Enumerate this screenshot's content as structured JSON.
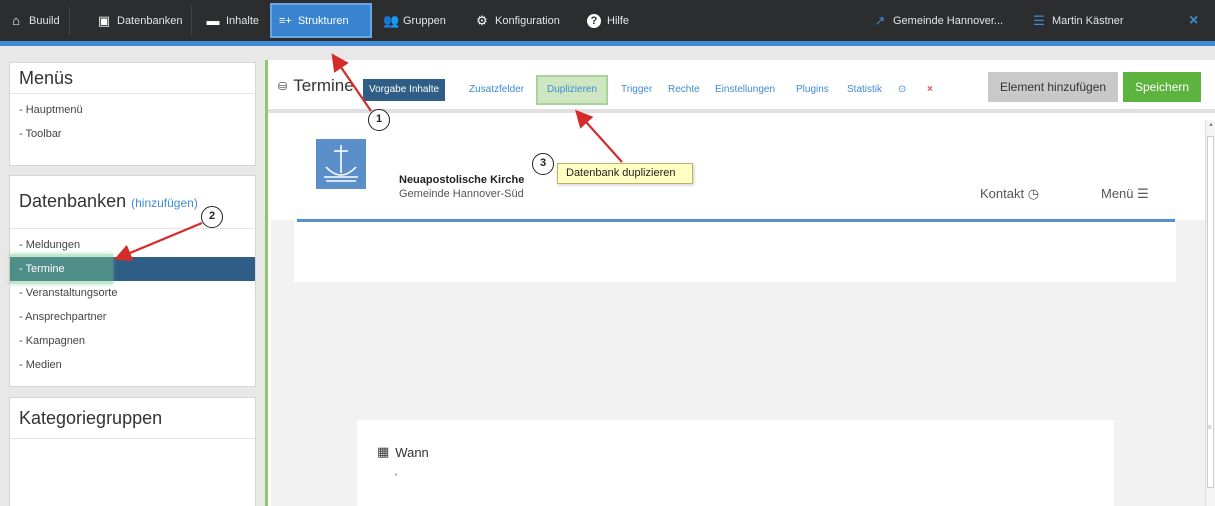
{
  "nav": {
    "items": [
      {
        "label": "Buuild",
        "icon": "home-icon"
      },
      {
        "label": "Datenbanken",
        "icon": "calendar-icon"
      },
      {
        "label": "Inhalte",
        "icon": "folder-icon"
      },
      {
        "label": "Strukturen",
        "icon": "structure-icon",
        "active": true
      },
      {
        "label": "Gruppen",
        "icon": "users-icon"
      },
      {
        "label": "Konfiguration",
        "icon": "gear-icon"
      },
      {
        "label": "Hilfe",
        "icon": "help-icon"
      }
    ],
    "site": "Gemeinde Hannover...",
    "user": "Martin Kästner",
    "close": "×",
    "struct_glyph": "≡+"
  },
  "sidebar": {
    "menus": {
      "title": "Menüs",
      "items": [
        "- Hauptmenü",
        "- Toolbar"
      ]
    },
    "databases": {
      "title": "Datenbanken",
      "add": "(hinzufügen)",
      "items": [
        "- Meldungen",
        "- Termine",
        "- Veranstaltungsorte",
        "- Ansprechpartner",
        "- Kampagnen",
        "- Medien"
      ],
      "selected_index": 1
    },
    "categories": {
      "title": "Kategoriegruppen"
    }
  },
  "toolbar": {
    "title": "Termine",
    "tabs": [
      "Vorgabe Inhalte",
      "Zusatzfelder",
      "Duplizieren",
      "Trigger",
      "Rechte",
      "Einstellungen",
      "Plugins",
      "Statistik"
    ],
    "info_icon": "⊙",
    "delete_icon": "×",
    "add_button": "Element hinzufügen",
    "save_button": "Speichern"
  },
  "preview": {
    "church": "Neuapostolische Kirche",
    "parish": "Gemeinde Hannover-Süd",
    "kontakt": "Kontakt",
    "kontakt_icon": "◷",
    "menu": "Menü",
    "menu_icon": "☰",
    "wann": "Wann",
    "wann_icon": "▦",
    "dot": "'"
  },
  "annotations": {
    "badges": [
      "1",
      "2",
      "3"
    ],
    "tooltip": "Datenbank duplizieren",
    "arrow_color": "#d42b2b"
  },
  "colors": {
    "accent": "#3f8bd4",
    "selected": "#2e5e85",
    "save": "#5cb33e",
    "topbar": "#2b2d2f"
  }
}
